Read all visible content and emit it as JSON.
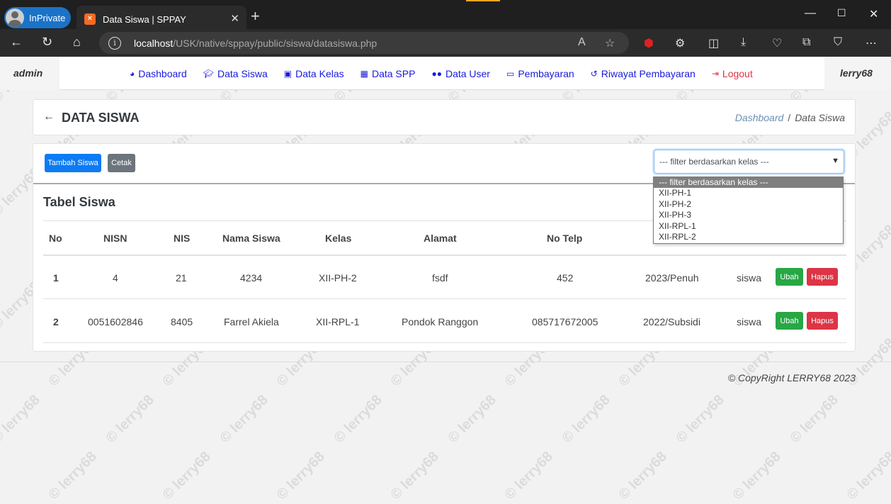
{
  "browser": {
    "profile_label": "InPrivate",
    "tab_title": "Data Siswa | SPPAY",
    "url_host": "localhost",
    "url_path": "/USK/native/sppay/public/siswa/datasiswa.php"
  },
  "nav": {
    "left_user": "admin",
    "right_user": "lerry68",
    "items": [
      {
        "label": "Dashboard",
        "icon": "tachometer-icon"
      },
      {
        "label": "Data Siswa",
        "icon": "graduation-cap-icon"
      },
      {
        "label": "Data Kelas",
        "icon": "id-badge-icon"
      },
      {
        "label": "Data SPP",
        "icon": "table-icon"
      },
      {
        "label": "Data User",
        "icon": "users-icon"
      },
      {
        "label": "Pembayaran",
        "icon": "money-icon"
      },
      {
        "label": "Riwayat Pembayaran",
        "icon": "history-icon"
      },
      {
        "label": "Logout",
        "icon": "sign-out-icon"
      }
    ]
  },
  "header": {
    "title": "DATA SISWA",
    "breadcrumb": [
      "Dashboard",
      "Data Siswa"
    ]
  },
  "toolbar": {
    "add_label": "Tambah Siswa",
    "print_label": "Cetak",
    "filter_value": "--- filter berdasarkan kelas ---"
  },
  "filter_options": [
    "--- filter berdasarkan kelas ---",
    "XII-PH-1",
    "XII-PH-2",
    "XII-PH-3",
    "XII-RPL-1",
    "XII-RPL-2"
  ],
  "table": {
    "title": "Tabel Siswa",
    "columns": [
      "No",
      "NISN",
      "NIS",
      "Nama Siswa",
      "Kelas",
      "Alamat",
      "No Telp"
    ],
    "rows": [
      {
        "no": "1",
        "nisn": "4",
        "nis": "21",
        "nama": "4234",
        "kelas": "XII-PH-2",
        "alamat": "fsdf",
        "telp": "452",
        "spp": "2023/Penuh",
        "user": "siswa",
        "edit": "Ubah",
        "delete": "Hapus"
      },
      {
        "no": "2",
        "nisn": "0051602846",
        "nis": "8405",
        "nama": "Farrel Akiela",
        "kelas": "XII-RPL-1",
        "alamat": "Pondok Ranggon",
        "telp": "085717672005",
        "spp": "2022/Subsidi",
        "user": "siswa",
        "edit": "Ubah",
        "delete": "Hapus"
      }
    ]
  },
  "footer": "© CopyRight LERRY68 2023",
  "watermark": "© lerry68",
  "colors": {
    "primary": "#0d7bf4",
    "success": "#28a745",
    "danger": "#dc3545",
    "secondary": "#6c757d",
    "nav_link": "#1a1adb"
  }
}
